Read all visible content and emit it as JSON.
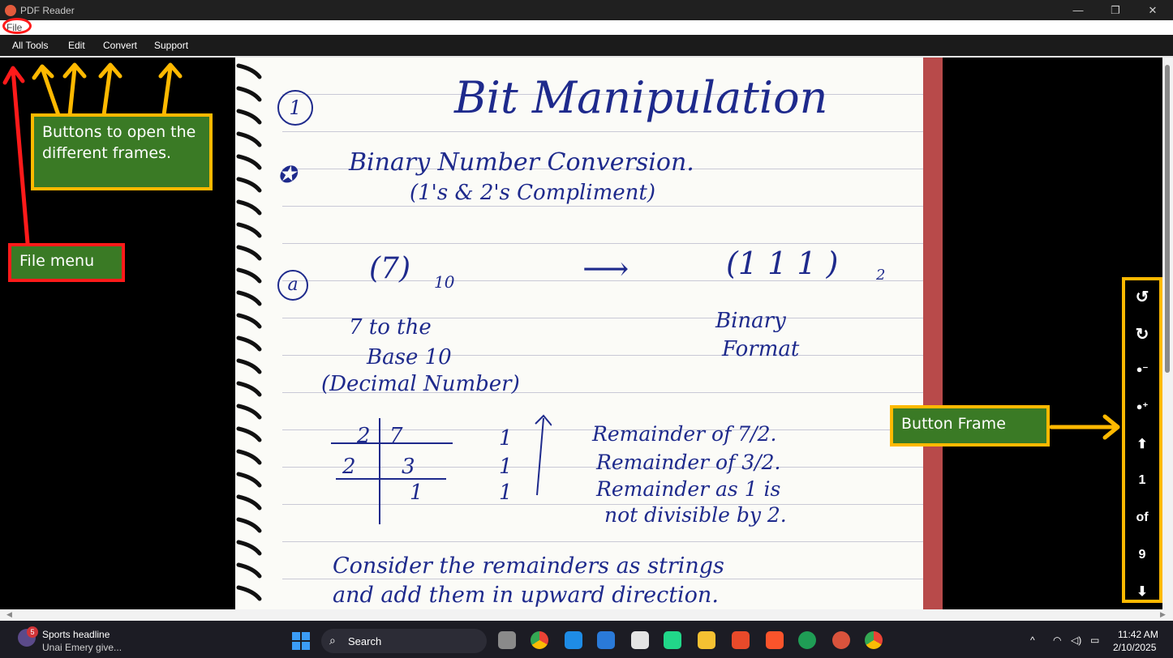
{
  "window": {
    "title": "PDF Reader",
    "controls": [
      "—",
      "❐",
      "✕"
    ]
  },
  "menubar": {
    "file": "File"
  },
  "toolbar": {
    "all_tools": "All Tools",
    "edit": "Edit",
    "convert": "Convert",
    "support": "Support"
  },
  "annotations": {
    "buttons_callout": "Buttons to open the different frames.",
    "file_menu_callout": "File menu",
    "button_frame_callout": "Button Frame",
    "arrow_color": "#ffb900",
    "file_color": "#ff1a1a"
  },
  "document": {
    "title": "Bit Manipulation",
    "number": "1",
    "heading_line1": "Binary Number Conversion.",
    "heading_line2": "(1's & 2's Compliment)",
    "example_left": "(7)",
    "example_left_sub": "10",
    "arrow": "⟶",
    "example_right": "(1 1 1 )",
    "example_right_sub": "2",
    "note_left1": "7 to the",
    "note_left2": "Base 10",
    "note_left3": "(Decimal Number)",
    "note_right1": "Binary",
    "note_right2": "Format",
    "div_r1_a": "2",
    "div_r1_b": "7",
    "div_r2_a": "2",
    "div_r2_b": "3",
    "div_r3_b": "1",
    "remainders": [
      "1",
      "1",
      "1"
    ],
    "rem_note1": "Remainder of 7/2.",
    "rem_note2": "Remainder of 3/2.",
    "rem_note3": "Remainder as 1 is",
    "rem_note4": "not divisible by 2.",
    "footer1": "Consider the remainders as strings",
    "footer2": "and add them in upward direction."
  },
  "frame_buttons": {
    "rotate_left": "↺",
    "rotate_right": "↻",
    "zoom_out": "●⁻",
    "zoom_in": "●⁺",
    "prev": "⬆",
    "current_page": "1",
    "of_label": "of",
    "total_pages": "9",
    "next": "⬇"
  },
  "taskbar": {
    "news_badge": "5",
    "news_title": "Sports headline",
    "news_subtitle": "Unai Emery give...",
    "search_label": "Search",
    "time": "11:42 AM",
    "date": "2/10/2025",
    "chevron": "^"
  }
}
